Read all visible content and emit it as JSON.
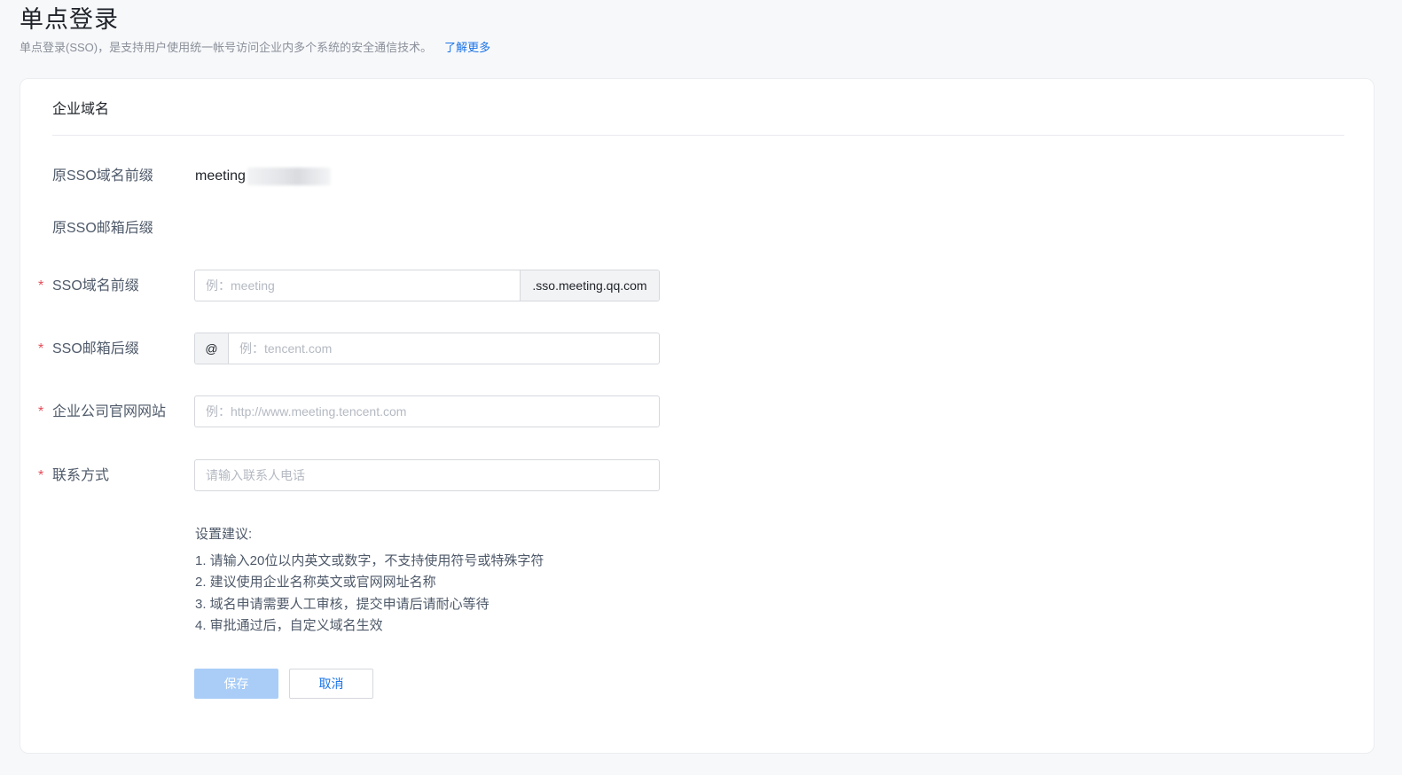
{
  "header": {
    "title": "单点登录",
    "description": "单点登录(SSO)，是支持用户使用统一帐号访问企业内多个系统的安全通信技术。",
    "learn_more": "了解更多"
  },
  "card": {
    "section_title": "企业域名",
    "fields": {
      "old_domain_prefix": {
        "label": "原SSO域名前缀",
        "value": "meeting"
      },
      "old_email_suffix": {
        "label": "原SSO邮箱后缀",
        "value": ""
      },
      "domain_prefix": {
        "required_mark": "*",
        "label": "SSO域名前缀",
        "placeholder": "例：meeting",
        "value": "",
        "suffix": ".sso.meeting.qq.com"
      },
      "email_suffix": {
        "required_mark": "*",
        "label": "SSO邮箱后缀",
        "prefix": "@",
        "placeholder": "例：tencent.com",
        "value": ""
      },
      "website": {
        "required_mark": "*",
        "label": "企业公司官网网站",
        "placeholder": "例：http://www.meeting.tencent.com",
        "value": ""
      },
      "contact": {
        "required_mark": "*",
        "label": "联系方式",
        "placeholder": "请输入联系人电话",
        "value": ""
      }
    },
    "tips": {
      "title": "设置建议:",
      "items": [
        "1. 请输入20位以内英文或数字，不支持使用符号或特殊字符",
        "2. 建议使用企业名称英文或官网网址名称",
        "3. 域名申请需要人工审核，提交申请后请耐心等待",
        "4. 审批通过后，自定义域名生效"
      ]
    },
    "buttons": {
      "save": "保存",
      "cancel": "取消"
    }
  }
}
